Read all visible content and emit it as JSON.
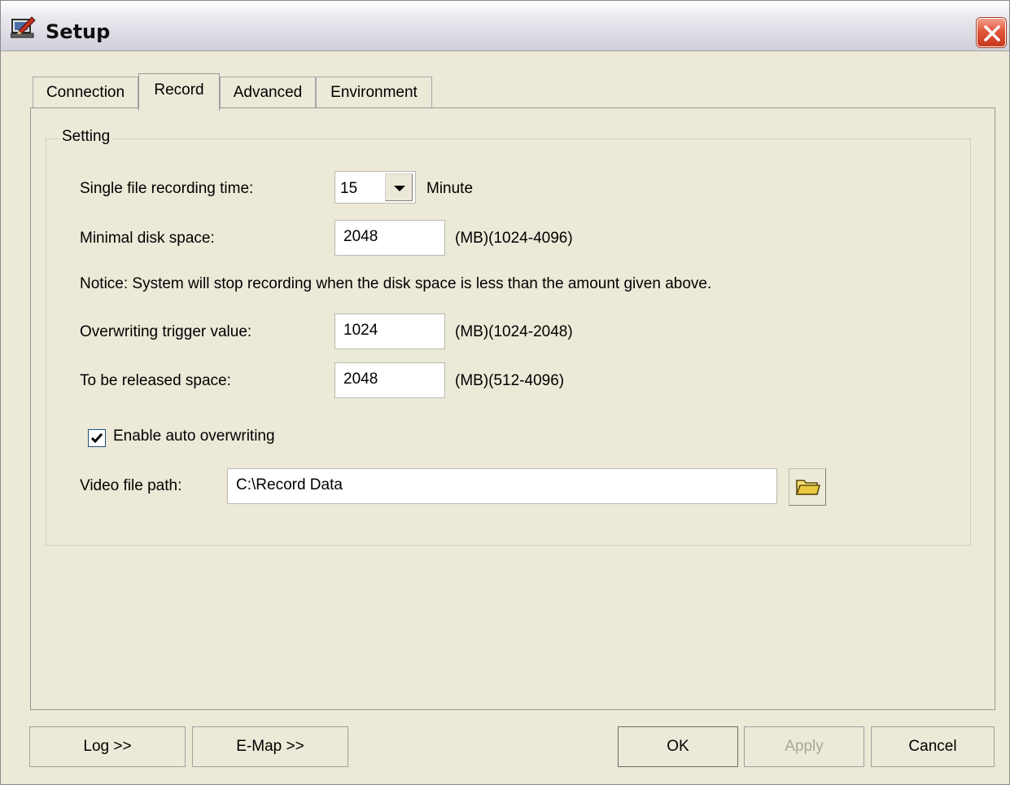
{
  "window": {
    "title": "Setup",
    "close_icon": "close-icon",
    "app_icon": "setup-icon"
  },
  "tabs": [
    {
      "label": "Connection",
      "selected": false
    },
    {
      "label": "Record",
      "selected": true
    },
    {
      "label": "Advanced",
      "selected": false
    },
    {
      "label": "Environment",
      "selected": false
    }
  ],
  "setting": {
    "group_title": "Setting",
    "recording_time_label": "Single file recording time:",
    "recording_time_value": "15",
    "recording_time_unit": "Minute",
    "min_disk_label": "Minimal disk space:",
    "min_disk_value": "2048",
    "min_disk_range": "(MB)(1024-4096)",
    "notice": "Notice: System will stop recording when the disk space is less than the amount given above.",
    "overwrite_trigger_label": "Overwriting trigger value:",
    "overwrite_trigger_value": "1024",
    "overwrite_trigger_range": "(MB)(1024-2048)",
    "release_label": "To be released space:",
    "release_value": "2048",
    "release_range": "(MB)(512-4096)",
    "auto_overwrite_label": "Enable auto overwriting",
    "auto_overwrite_checked": true,
    "video_path_label": "Video file path:",
    "video_path_value": "C:\\Record Data",
    "browse_icon": "folder-icon"
  },
  "buttons": {
    "log": "Log >>",
    "emap": "E-Map >>",
    "ok": "OK",
    "apply": "Apply",
    "cancel": "Cancel"
  }
}
